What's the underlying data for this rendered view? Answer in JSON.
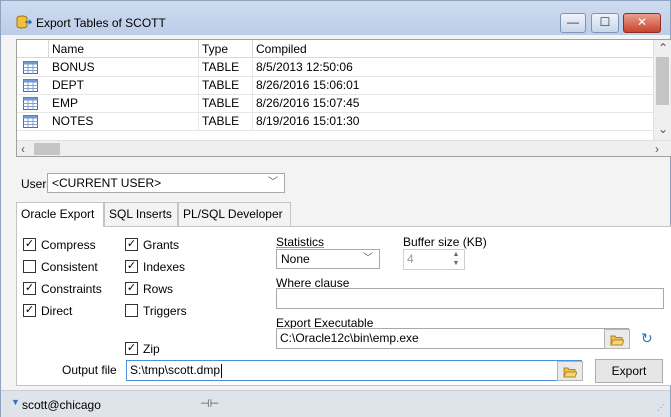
{
  "window": {
    "title": "Export Tables of SCOTT",
    "minimize": "—",
    "maximize": "☐",
    "close": "✕"
  },
  "grid": {
    "columns": [
      "Name",
      "Type",
      "Compiled"
    ],
    "rows": [
      {
        "name": "BONUS",
        "type": "TABLE",
        "compiled": "8/5/2013 12:50:06"
      },
      {
        "name": "DEPT",
        "type": "TABLE",
        "compiled": "8/26/2016 15:06:01"
      },
      {
        "name": "EMP",
        "type": "TABLE",
        "compiled": "8/26/2016 15:07:45"
      },
      {
        "name": "NOTES",
        "type": "TABLE",
        "compiled": "8/19/2016 15:01:30"
      }
    ]
  },
  "user": {
    "label": "User",
    "value": "<CURRENT USER>"
  },
  "tabs": [
    "Oracle Export",
    "SQL Inserts",
    "PL/SQL Developer"
  ],
  "options": {
    "compress": {
      "label": "Compress",
      "checked": true
    },
    "consistent": {
      "label": "Consistent",
      "checked": false
    },
    "constraints": {
      "label": "Constraints",
      "checked": true
    },
    "direct": {
      "label": "Direct",
      "checked": true
    },
    "grants": {
      "label": "Grants",
      "checked": true
    },
    "indexes": {
      "label": "Indexes",
      "checked": true
    },
    "rows": {
      "label": "Rows",
      "checked": true
    },
    "triggers": {
      "label": "Triggers",
      "checked": false
    },
    "zip": {
      "label": "Zip",
      "checked": true
    }
  },
  "statistics": {
    "label": "Statistics",
    "value": "None"
  },
  "buffer": {
    "label": "Buffer size (KB)",
    "value": "4"
  },
  "where": {
    "label": "Where clause",
    "value": ""
  },
  "executable": {
    "label": "Export Executable",
    "value": "C:\\Oracle12c\\bin\\emp.exe"
  },
  "output": {
    "label": "Output file",
    "value": "S:\\tmp\\scott.dmp"
  },
  "export_button": "Export",
  "status": {
    "connection": "scott@chicago"
  }
}
